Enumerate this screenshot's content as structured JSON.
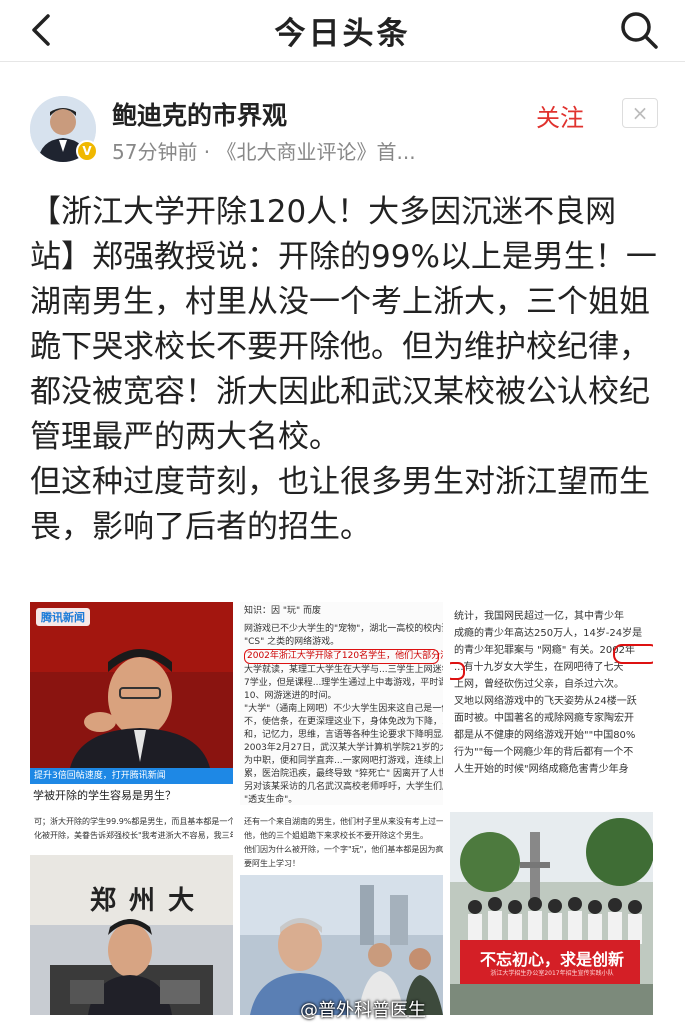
{
  "header": {
    "app_title": "今日头条",
    "back_icon": "back-arrow-icon",
    "search_icon": "search-icon"
  },
  "author": {
    "name": "鲍迪克的市界观",
    "verified_badge": "V",
    "meta": "57分钟前 · 《北大商业评论》首...",
    "follow_label": "关注",
    "dismiss_label": "×",
    "accent_color": "#e0322e"
  },
  "article": {
    "paragraph_1": "【浙江大学开除120人！大多因沉迷不良网站】郑强教授说：开除的99%以上是男生！一湖南男生，村里从没一个考上浙大，三个姐姐跪下哭求校长不要开除他。但为维护校纪律，都没被宽容！浙大因此和武汉某校被公认校纪管理最严的两大名校。",
    "paragraph_2": "但这种过度苛刻，也让很多男生对浙江望而生畏，影响了后者的招生。"
  },
  "images": {
    "img1": {
      "logo_text": "腾讯新闻",
      "bar_text": "提升3倍回帖速度，打开腾讯新闻",
      "caption": "学被开除的学生容易是男生？"
    },
    "img2": {
      "top_text": "知识：因 \"玩\" 而废",
      "lines": [
        "网游戏已不少大学生的\"宠物\"，湖北一高校的校内调查表明，30%",
        "\"CS\" 之类的网络游戏。",
        "2002年浙江大学开除了120名学生，他们大部分沉迷于网络不能自拔",
        "大学就读，某理工大学生在大学与...三学生上网迷学校的管理了",
        "7学业，但是课程...理学生通过上中毒游戏，平时课程了，现在已经16",
        "10、网游迷进的时间。",
        "\"大学\"（通南上网吧）不少大学生因来这自己是一件，同一的课必理",
        "不，使信条，在更深理这业下，身体免改为下降，...就成力下降",
        "和，记忆力，思维，言语等各种生论要求下降明显。",
        "2003年2月27日，武汉某大学计算机学院21岁的大一学生康某上午课程",
        "为中职，便和同学直奔...一家网吧打游戏，连续上网5小时后",
        "累，医治院迅疾，最终导致 \"猝死亡\" 因离开了人世。",
        "另对该某采访的几名武汉高校老师呼吁，大学生们应警惕，即便",
        "\"透支生命\"。"
      ],
      "highlight_line_index": 2
    },
    "img3": {
      "lines": [
        "统计，我国网民超过一亿，其中青少年",
        "成瘾的青少年高达250万人，14岁-24岁是",
        "的青少年犯罪案与 \"网瘾\" 有关。2002年",
        "...有十九岁女大学生，在网吧待了七天",
        "上网，曾经砍伤过父亲，自杀过六次。",
        "叉地以网络游戏中的飞天姿势从24楼一跃",
        "面时被。中国著名的戒除网瘾专家陶宏开",
        "都是从不健康的网络游戏开始\"\"中国80%",
        "行为\"\"每一个网瘾少年的背后都有一个不",
        "人生开始的时候\"网络成瘾危害青少年身"
      ]
    },
    "img4": {
      "lines": [
        "可；浙大开除的学生99.9%都是男生，而且基本都是一个原因。",
        "化被开除，美眷告诉郑强校长\"我考进浙大不容易，我三年没有回"
      ],
      "sign_text": "郑 州 大"
    },
    "img5": {
      "lines": [
        "还有一个来自湖南的男生，他们村子里从来没有考上过一个浙",
        "他，他的三个姐姐跪下来求校长不要开除这个男生。",
        "他们因为什么被开除，一个字\"玩\"，他们基本都是因为疯狂玩网",
        "要阿生上学习！"
      ]
    },
    "img6": {
      "banner_main": "不忘初心，求是创新",
      "banner_sub": "浙江大学招生办公室2017年招生宣传实践小队"
    }
  },
  "watermark": "@普外科普医生"
}
